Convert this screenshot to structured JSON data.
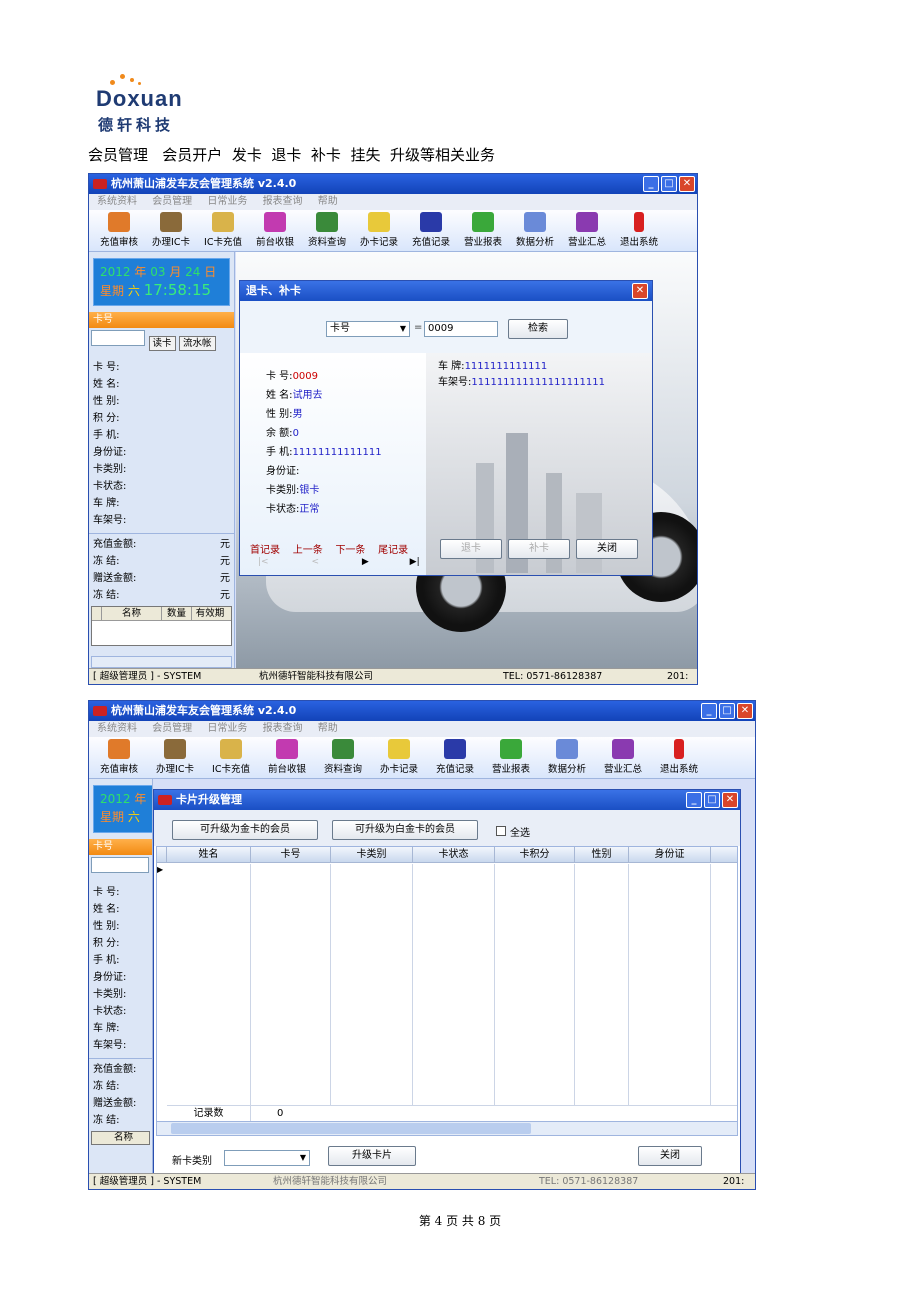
{
  "logo": {
    "word": "Doxuan",
    "chinese": "德轩科技"
  },
  "caption": "会员管理   会员开户  发卡  退卡  补卡  挂失  升级等相关业务",
  "app": {
    "title": "杭州萧山浦发车友会管理系统 v2.4.0",
    "menu": [
      "系统资料",
      "会员管理",
      "日常业务",
      "报表查询",
      "帮助"
    ],
    "toolbar": [
      "充值审核",
      "办理IC卡",
      "IC卡充值",
      "前台收银",
      "资料查询",
      "办卡记录",
      "充值记录",
      "营业报表",
      "数据分析",
      "营业汇总",
      "退出系统"
    ],
    "clock": {
      "year": "2012",
      "year_unit": "年",
      "month": "03",
      "month_unit": "月",
      "day": "24",
      "day_unit": "日",
      "weekday_label": "星期",
      "weekday": "六",
      "time": "17:58:15"
    },
    "card_label": "卡号",
    "read_card": "读卡",
    "flow_account": "流水帐",
    "fields": [
      "卡  号:",
      "姓  名:",
      "性  别:",
      "积  分:",
      "手  机:",
      "身份证:",
      "卡类别:",
      "卡状态:",
      "车  牌:",
      "车架号:"
    ],
    "money_fields": [
      "充值金额:",
      "冻    结:",
      "赠送金额:",
      "冻    结:"
    ],
    "money_unit": "元",
    "gift_table_headers": [
      "名称",
      "数量",
      "有效期"
    ],
    "status_user": "[ 超级管理员 ] - SYSTEM",
    "status_company": "杭州德轩智能科技有限公司",
    "status_tel": "TEL: 0571-86128387",
    "status_date": "201:"
  },
  "dialog1": {
    "title": "退卡、补卡",
    "search_field": "卡号",
    "eq": "=",
    "search_value": "0009",
    "search_button": "检索",
    "info": [
      {
        "label": "卡  号:",
        "value": "0009"
      },
      {
        "label": "姓  名:",
        "value": "试用去"
      },
      {
        "label": "性  别:",
        "value": "男"
      },
      {
        "label": "余  额:",
        "value": "0"
      },
      {
        "label": "手  机:",
        "value": "11111111111111"
      },
      {
        "label": "身份证:",
        "value": ""
      },
      {
        "label": "卡类别:",
        "value": "银卡"
      },
      {
        "label": "卡状态:",
        "value": "正常"
      }
    ],
    "plate_label": "车  牌:",
    "plate_value": "1111111111111",
    "frame_label": "车架号:",
    "frame_value": "111111111111111111111",
    "nav": [
      "首记录",
      "上一条",
      "下一条",
      "尾记录"
    ],
    "nav_symbols": [
      "|<",
      "<",
      "▶",
      "▶|"
    ],
    "return_button": "退卡",
    "reissue_button": "补卡",
    "close_button": "关闭"
  },
  "dialog2": {
    "title": "卡片升级管理",
    "gold_button": "可升级为金卡的会员",
    "platinum_button": "可升级为白金卡的会员",
    "select_all": "全选",
    "columns": [
      "姓名",
      "卡号",
      "卡类别",
      "卡状态",
      "卡积分",
      "性别",
      "身份证"
    ],
    "record_label": "记录数",
    "record_count": "0",
    "new_type_label": "新卡类别",
    "upgrade_button": "升级卡片",
    "close_button": "关闭"
  },
  "page_footer": "第 4 页 共 8 页"
}
